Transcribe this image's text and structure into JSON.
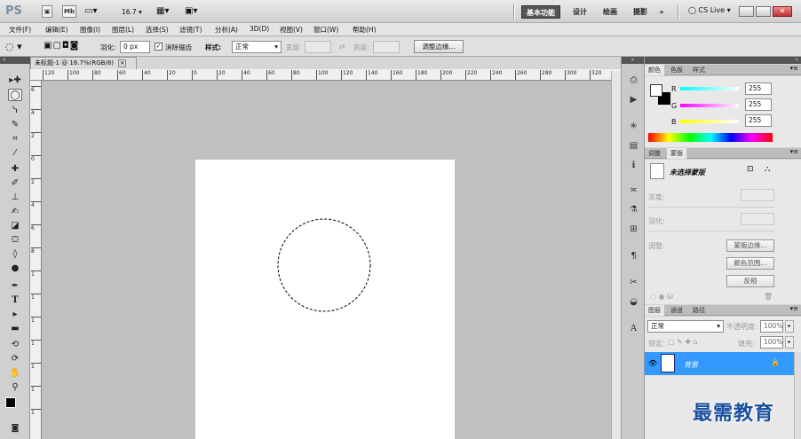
{
  "app": {
    "logo": "PS",
    "mb": "Mb",
    "zoom": "16.7",
    "workspace_tabs": [
      "基本功能",
      "设计",
      "绘画",
      "摄影"
    ],
    "more": "»",
    "cs_live": "CS Live"
  },
  "menu": [
    "文件(F)",
    "编辑(E)",
    "图像(I)",
    "图层(L)",
    "选择(S)",
    "滤镜(T)",
    "分析(A)",
    "3D(D)",
    "视图(V)",
    "窗口(W)",
    "帮助(H)"
  ],
  "options": {
    "feather_label": "羽化:",
    "feather_value": "0 px",
    "antialias_label": "消除锯齿",
    "style_label": "样式:",
    "style_value": "正常",
    "width_label": "宽度:",
    "height_label": "高度:",
    "refine_edge": "调整边缘..."
  },
  "document": {
    "tab_title": "未标题-1 @ 16.7%(RGB/8)",
    "ruler_ticks": [
      "120",
      "100",
      "80",
      "60",
      "40",
      "20",
      "0",
      "20",
      "40",
      "60",
      "80",
      "100",
      "120",
      "140",
      "160",
      "180",
      "200",
      "220",
      "240",
      "260",
      "280",
      "300",
      "320"
    ],
    "left_ruler_ticks": [
      "6",
      "4",
      "2",
      "0",
      "2",
      "4",
      "6",
      "8",
      "1",
      "1",
      "1",
      "1",
      "1",
      "1",
      "1",
      "1"
    ]
  },
  "color_panel": {
    "tabs": [
      "颜色",
      "色板",
      "样式"
    ],
    "r_label": "R",
    "g_label": "G",
    "b_label": "B",
    "r_value": "255",
    "g_value": "255",
    "b_value": "255"
  },
  "mask_panel": {
    "tabs": [
      "调整",
      "蒙版"
    ],
    "title": "未选择蒙版",
    "density_label": "浓度:",
    "feather_label": "羽化:",
    "refine_label": "调整:",
    "mask_edge_button": "蒙版边缘...",
    "color_range_button": "颜色范围...",
    "invert_button": "反相"
  },
  "layers_panel": {
    "tabs": [
      "图层",
      "通道",
      "路径"
    ],
    "blend_mode": "正常",
    "opacity_label": "不透明度:",
    "opacity_value": "100%",
    "lock_label": "锁定:",
    "fill_label": "填充:",
    "fill_value": "100%",
    "layer_name": "背景"
  },
  "watermark": "最需教育",
  "colors": {
    "accent": "#3399ff",
    "canvas_bg": "#c0c0c0",
    "marquee": "#000000"
  }
}
